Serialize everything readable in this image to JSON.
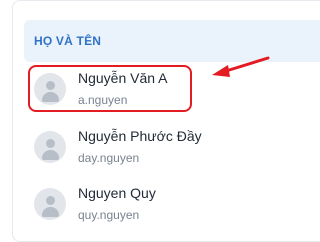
{
  "header": {
    "label": "HỌ VÀ TÊN"
  },
  "users": [
    {
      "name": "Nguyễn Văn A",
      "username": "a.nguyen"
    },
    {
      "name": "Nguyễn Phước Đầy",
      "username": "day.nguyen"
    },
    {
      "name": "Nguyen Quy",
      "username": "quy.nguyen"
    }
  ],
  "colors": {
    "header_bg": "#eaf2fb",
    "header_text": "#2f73c6",
    "highlight": "#e31b23"
  }
}
